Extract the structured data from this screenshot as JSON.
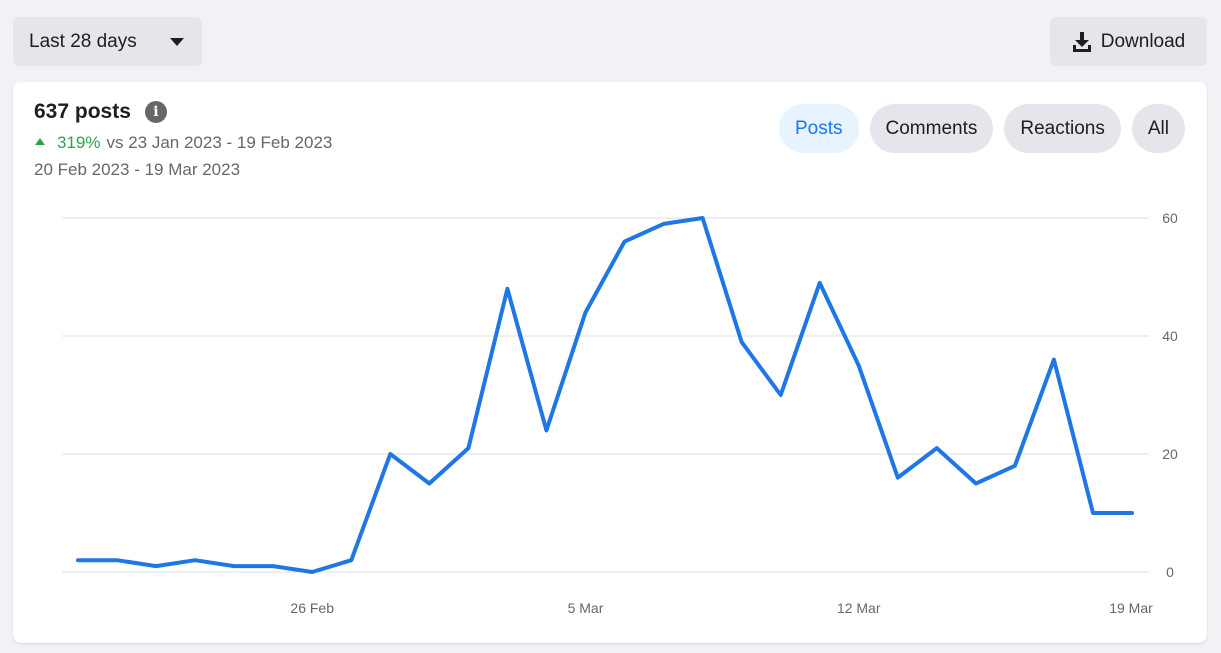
{
  "date_range": {
    "label": "Last 28 days"
  },
  "download": {
    "label": "Download"
  },
  "summary": {
    "total": "637 posts",
    "change_pct": "319%",
    "change_text": "vs 23 Jan 2023 - 19 Feb 2023",
    "period": "20 Feb 2023 - 19 Mar 2023"
  },
  "tabs": [
    {
      "label": "Posts",
      "active": true
    },
    {
      "label": "Comments",
      "active": false
    },
    {
      "label": "Reactions",
      "active": false
    },
    {
      "label": "All",
      "active": false
    }
  ],
  "colors": {
    "line": "#1f77e5",
    "positive": "#31a24c",
    "accent": "#1877f2"
  },
  "chart_data": {
    "type": "line",
    "title": "",
    "xlabel": "",
    "ylabel": "",
    "x_ticks": [
      "26 Feb",
      "5 Mar",
      "12 Mar",
      "19 Mar"
    ],
    "y_ticks": [
      0,
      20,
      40,
      60
    ],
    "ylim": [
      0,
      60
    ],
    "grid": true,
    "x": [
      "20 Feb",
      "21 Feb",
      "22 Feb",
      "23 Feb",
      "24 Feb",
      "25 Feb",
      "26 Feb",
      "27 Feb",
      "28 Feb",
      "1 Mar",
      "2 Mar",
      "3 Mar",
      "4 Mar",
      "5 Mar",
      "6 Mar",
      "7 Mar",
      "8 Mar",
      "9 Mar",
      "10 Mar",
      "11 Mar",
      "12 Mar",
      "13 Mar",
      "14 Mar",
      "15 Mar",
      "16 Mar",
      "17 Mar",
      "18 Mar",
      "19 Mar"
    ],
    "series": [
      {
        "values": [
          2,
          2,
          1,
          2,
          1,
          1,
          0,
          2,
          20,
          15,
          21,
          48,
          24,
          44,
          56,
          59,
          60,
          39,
          30,
          49,
          35,
          16,
          21,
          15,
          18,
          36,
          10,
          10
        ]
      }
    ]
  }
}
